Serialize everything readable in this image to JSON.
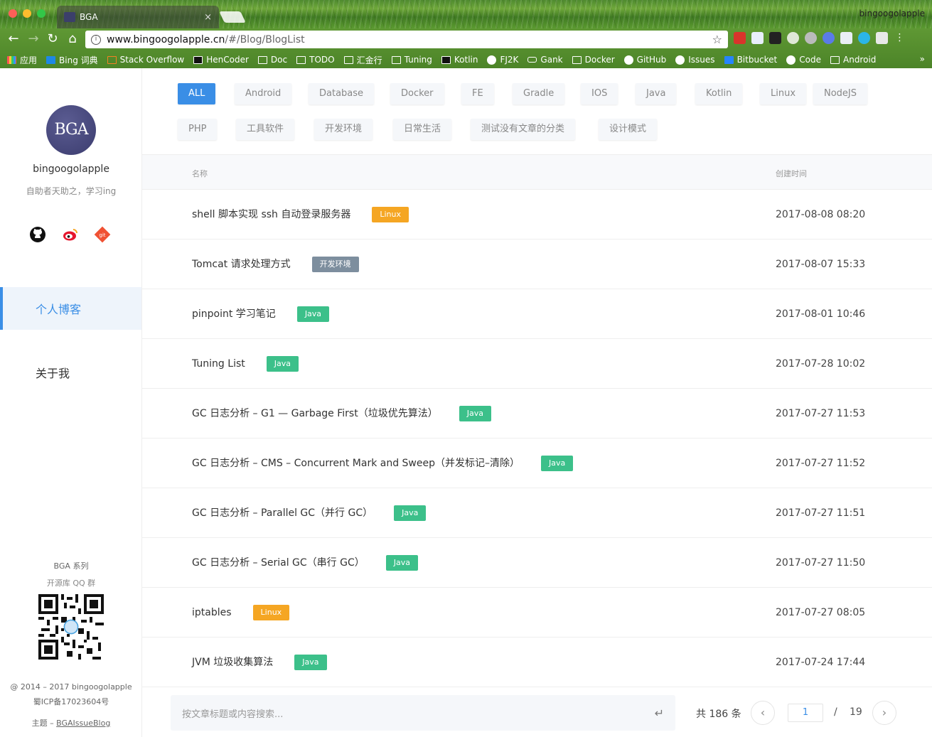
{
  "browser": {
    "tab_title": "BGA",
    "tab_close": "×",
    "profile_name": "bingoogolapple",
    "url_host": "www.bingoogolapple.cn",
    "url_path": "/#/Blog/BlogList",
    "bookmarks_more": "»",
    "bookmarks": [
      {
        "label": "应用"
      },
      {
        "label": "Bing 词典"
      },
      {
        "label": "Stack Overflow"
      },
      {
        "label": "HenCoder"
      },
      {
        "label": "Doc"
      },
      {
        "label": "TODO"
      },
      {
        "label": "汇金行"
      },
      {
        "label": "Tuning"
      },
      {
        "label": "Kotlin"
      },
      {
        "label": "FJ2K"
      },
      {
        "label": "Gank"
      },
      {
        "label": "Docker"
      },
      {
        "label": "GitHub"
      },
      {
        "label": "Issues"
      },
      {
        "label": "Bitbucket"
      },
      {
        "label": "Code"
      },
      {
        "label": "Android"
      }
    ]
  },
  "sidebar": {
    "avatar_text": "BGA",
    "username": "bingoogolapple",
    "motto": "自助者天助之，学习ing",
    "menu": [
      "个人博客",
      "关于我"
    ],
    "foot_series": "BGA 系列",
    "foot_qq": "开源库 QQ 群",
    "copyright": "@ 2014 – 2017 bingoogolapple",
    "icp": "蜀ICP备17023604号",
    "theme_prefix": "主题 – ",
    "theme_link": "BGAIssueBlog"
  },
  "categories": [
    "ALL",
    "Android",
    "Database",
    "Docker",
    "FE",
    "Gradle",
    "IOS",
    "Java",
    "Kotlin",
    "Linux",
    "NodeJS",
    "PHP",
    "工具软件",
    "开发环境",
    "日常生活",
    "测试没有文章的分类",
    "设计模式"
  ],
  "table": {
    "col_name": "名称",
    "col_time": "创建时间",
    "rows": [
      {
        "title": "shell 脚本实现 ssh 自动登录服务器",
        "tag": "Linux",
        "date": "2017-08-08 08:20"
      },
      {
        "title": "Tomcat 请求处理方式",
        "tag": "开发环境",
        "date": "2017-08-07 15:33"
      },
      {
        "title": "pinpoint 学习笔记",
        "tag": "Java",
        "date": "2017-08-01 10:46"
      },
      {
        "title": "Tuning List",
        "tag": "Java",
        "date": "2017-07-28 10:02"
      },
      {
        "title": "GC 日志分析 – G1 — Garbage First（垃圾优先算法）",
        "tag": "Java",
        "date": "2017-07-27 11:53"
      },
      {
        "title": "GC 日志分析 – CMS – Concurrent Mark and Sweep（并发标记–清除）",
        "tag": "Java",
        "date": "2017-07-27 11:52"
      },
      {
        "title": "GC 日志分析 – Parallel GC（并行 GC）",
        "tag": "Java",
        "date": "2017-07-27 11:51"
      },
      {
        "title": "GC 日志分析 – Serial GC（串行 GC）",
        "tag": "Java",
        "date": "2017-07-27 11:50"
      },
      {
        "title": "iptables",
        "tag": "Linux",
        "date": "2017-07-27 08:05"
      },
      {
        "title": "JVM 垃圾收集算法",
        "tag": "Java",
        "date": "2017-07-24 17:44"
      }
    ]
  },
  "tag_colors": {
    "Linux": "#f5a623",
    "Java": "#3cc08a",
    "开发环境": "#7d8e9e"
  },
  "search": {
    "placeholder": "按文章标题或内容搜索...",
    "enter_icon": "↵"
  },
  "pagination": {
    "total": "共 186 条",
    "current": "1",
    "sep": "/",
    "pages": "19",
    "prev": "‹",
    "next": "›"
  },
  "accent": "#3a8ee6"
}
